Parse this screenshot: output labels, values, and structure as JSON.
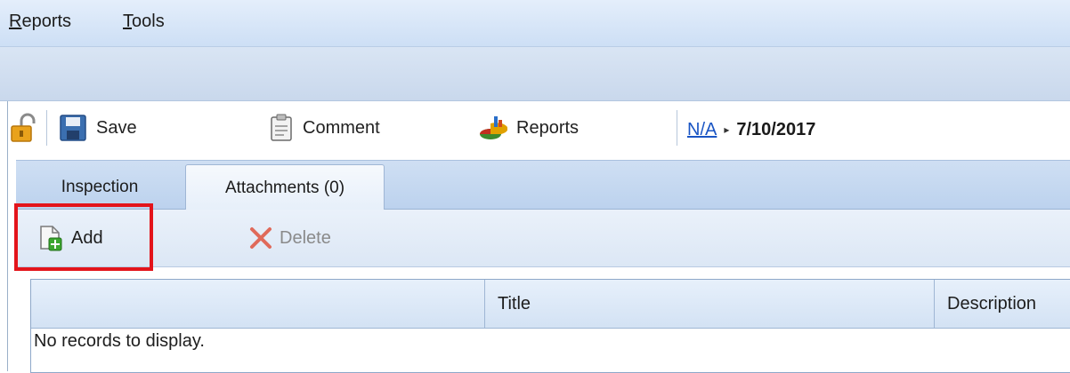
{
  "menu": {
    "reports": {
      "accel": "R",
      "rest": "eports"
    },
    "tools": {
      "accel": "T",
      "rest": "ools"
    }
  },
  "toolbar": {
    "save_label": "Save",
    "comment_label": "Comment",
    "reports_label": "Reports",
    "breadcrumb": {
      "link": "N/A",
      "date": "7/10/2017"
    }
  },
  "tabs": [
    {
      "label": "Inspection",
      "selected": false
    },
    {
      "label": "Attachments (0)",
      "selected": true
    }
  ],
  "grid_toolbar": {
    "add_label": "Add",
    "delete_label": "Delete"
  },
  "grid": {
    "columns": [
      "",
      "Title",
      "Description"
    ],
    "empty_message": "No records to display."
  },
  "colors": {
    "highlight": "#e3141b",
    "link": "#1a55c4"
  }
}
